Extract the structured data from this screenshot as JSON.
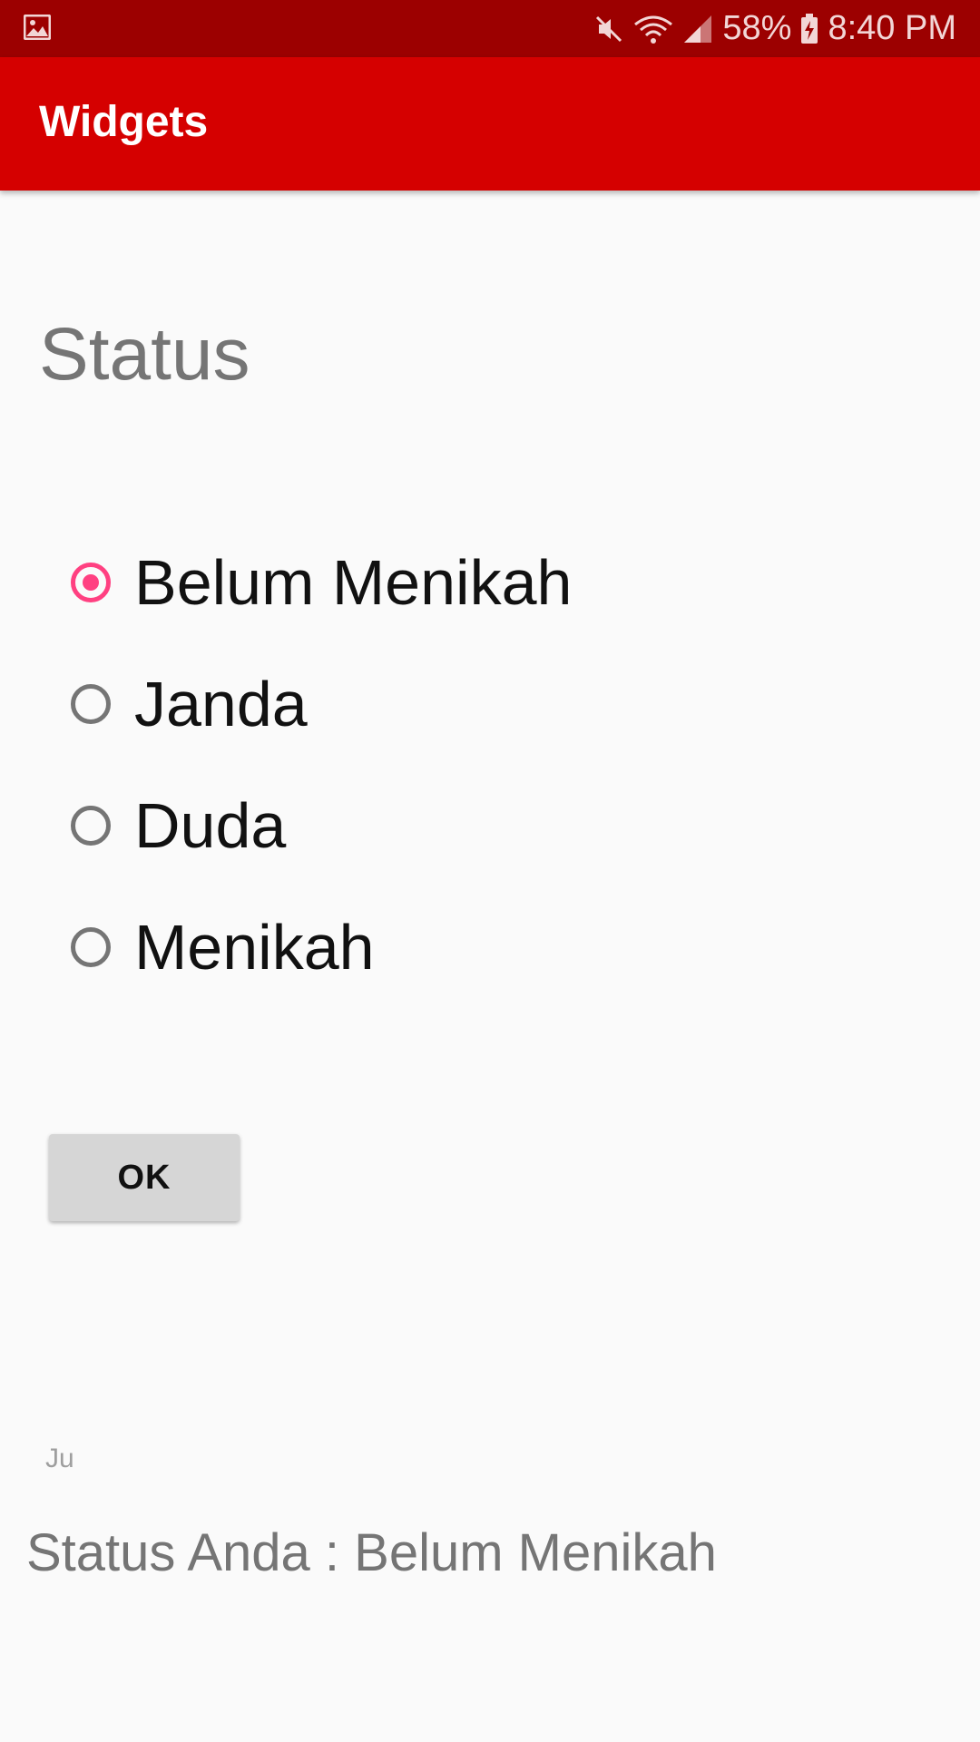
{
  "status_bar": {
    "gallery_icon": "image-icon",
    "mute_icon": "mute-icon",
    "wifi_icon": "wifi-icon",
    "signal_icon": "signal-icon",
    "battery_icon": "battery-charging-icon",
    "battery": "58%",
    "time": "8:40 PM"
  },
  "app_bar": {
    "title": "Widgets",
    "color": "#d50000"
  },
  "form": {
    "heading": "Status",
    "options": [
      {
        "label": "Belum Menikah",
        "checked": true
      },
      {
        "label": "Janda",
        "checked": false
      },
      {
        "label": "Duda",
        "checked": false
      },
      {
        "label": "Menikah",
        "checked": false
      }
    ],
    "accent_color": "#ff4081",
    "ok_label": "OK"
  },
  "toast_partial": "Ju",
  "result": "Status Anda : Belum Menikah"
}
